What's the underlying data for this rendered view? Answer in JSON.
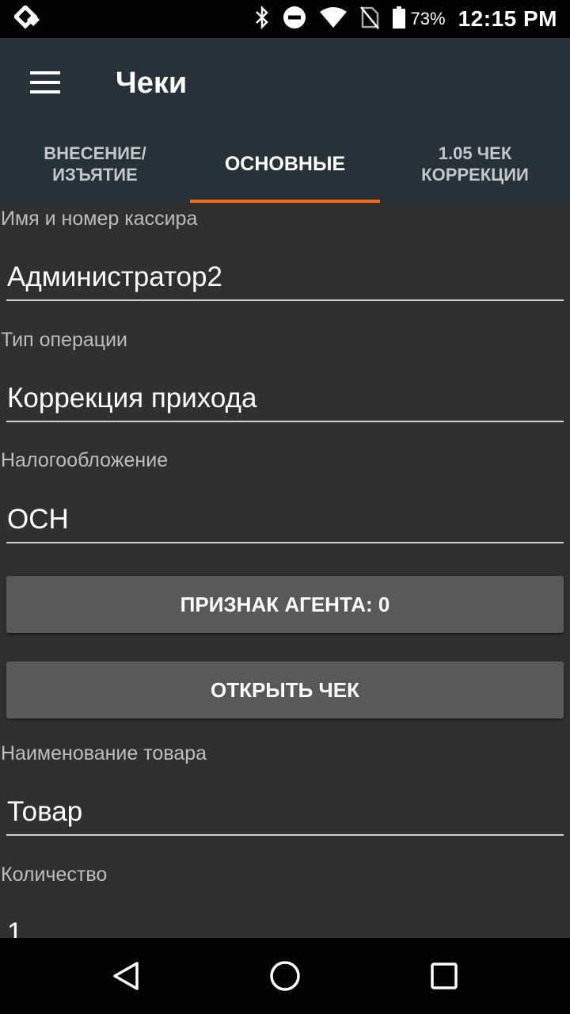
{
  "status_bar": {
    "battery_percent": "73%",
    "time": "12:15 PM",
    "icons": [
      "app-notification-icon",
      "bluetooth-icon",
      "do-not-disturb-icon",
      "wifi-icon",
      "no-sim-icon",
      "battery-icon"
    ]
  },
  "appbar": {
    "title": "Чеки",
    "menu_icon": "hamburger-menu-icon"
  },
  "tabs": [
    {
      "label": "ВНЕСЕНИЕ/\nИЗЪЯТИЕ",
      "active": false
    },
    {
      "label": "ОСНОВНЫЕ",
      "active": true
    },
    {
      "label": "1.05 ЧЕК\nКОРРЕКЦИИ",
      "active": false
    }
  ],
  "form": {
    "cashier": {
      "label": "Имя и номер кассира",
      "value": "Администратор2"
    },
    "operation_type": {
      "label": "Тип операции",
      "value": "Коррекция прихода"
    },
    "taxation": {
      "label": "Налогообложение",
      "value": "ОСН"
    },
    "agent_button": "ПРИЗНАК АГЕНТА: 0",
    "open_check_button": "ОТКРЫТЬ ЧЕК",
    "product_name": {
      "label": "Наименование товара",
      "value": "Товар"
    },
    "quantity": {
      "label": "Количество",
      "value": "1"
    }
  },
  "nav_bar": {
    "icons": [
      "back-icon",
      "home-icon",
      "recents-icon"
    ]
  },
  "colors": {
    "appbar": "#263238",
    "background": "#303030",
    "tab_indicator": "#f36a12",
    "button": "#595959"
  }
}
